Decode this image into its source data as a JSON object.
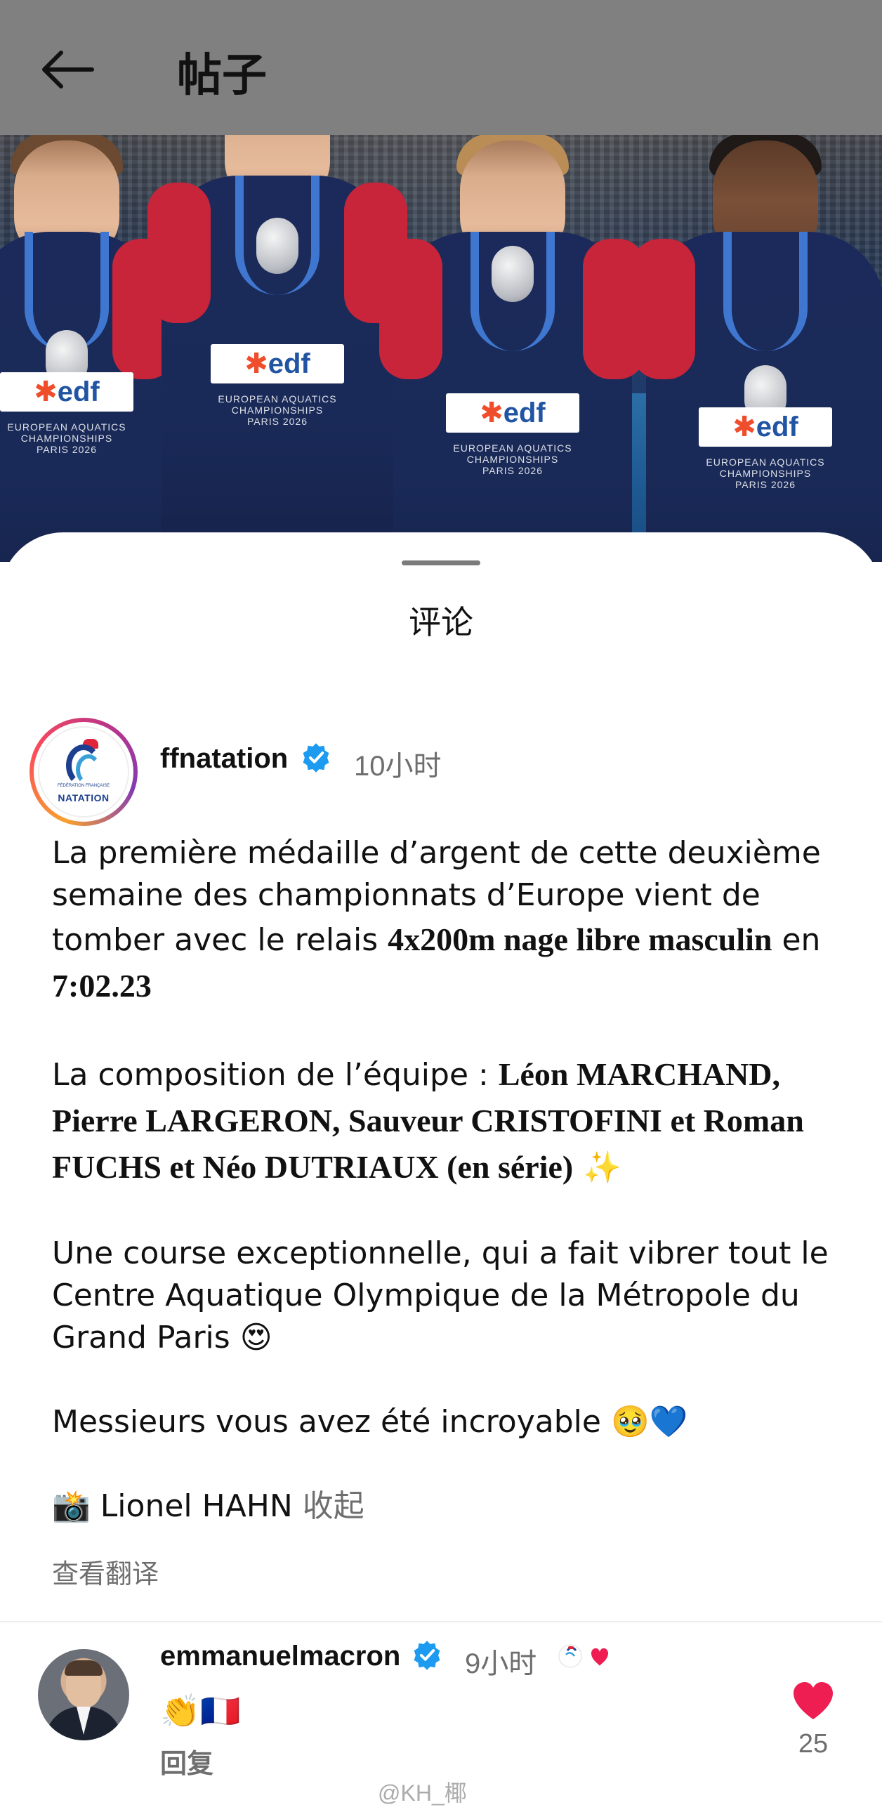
{
  "topbar": {
    "title": "帖子"
  },
  "sheet": {
    "title": "评论"
  },
  "post": {
    "username": "ffnatation",
    "time": "10小时",
    "avatar_text": "NATATION",
    "avatar_small_text": "FÉDÉRATION FRANÇAISE",
    "caption": {
      "p1_a": "La première médaille d’argent de cette deuxième semaine des championnats d’Europe vient de tomber avec le relais ",
      "p1_b": "4x200m nage libre masculin",
      "p1_c": " en ",
      "p1_d": "7:02.23",
      "p2_a": "La composition de l’équipe : ",
      "p2_b": "Léon MARCHAND, Pierre LARGERON, Sauveur CRISTOFINI et Roman FUCHS et Néo DUTRIAUX (en série)",
      "p2_emoji": "✨",
      "p3": "Une course exceptionnelle, qui a fait vibrer tout le Centre Aquatique Olympique de la Métropole du Grand Paris",
      "p3_emoji": "😍",
      "p4": "Messieurs vous avez été incroyable",
      "p4_emoji": "🥹💙",
      "p5_emoji": "📸",
      "p5": " Lionel HAHN",
      "collapse": "收起"
    },
    "translate": "查看翻译"
  },
  "comment": {
    "username": "emmanuelmacron",
    "time": "9小时",
    "text": "👏🇫🇷",
    "reply": "回复",
    "likes": "25"
  },
  "photo": {
    "sponsor": "edf",
    "banner": "EUROPEAN AQUATICS CHAMPIONSHIPS PARIS 2026"
  },
  "watermark": "@KH_椰",
  "colors": {
    "topbar_bg": "#808080",
    "verified": "#1d9bf0",
    "like": "#ee1d52",
    "muted_text": "#6e6e6e"
  },
  "icons": {
    "back": "arrow-left-icon",
    "verified": "verified-badge-icon",
    "like": "heart-filled-icon"
  }
}
